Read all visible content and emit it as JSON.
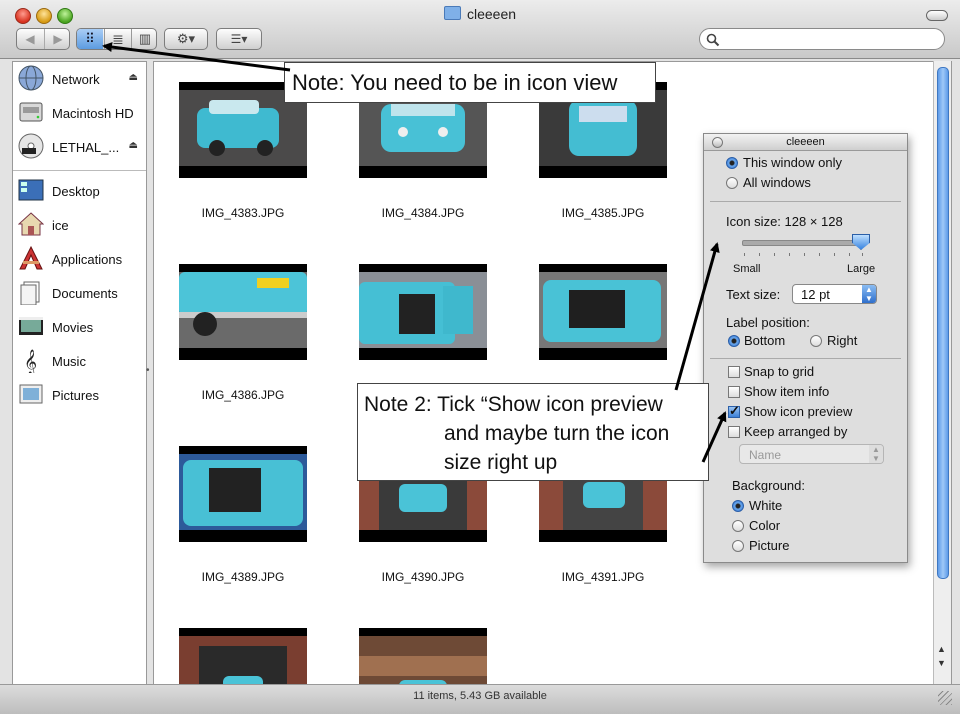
{
  "window": {
    "title": "cleeeen"
  },
  "toolbar": {
    "back_forward": [
      "◀",
      "▶"
    ],
    "view_modes": [
      {
        "name": "icon-view",
        "glyph": "⠿",
        "active": true
      },
      {
        "name": "list-view",
        "glyph": "≣",
        "active": false
      },
      {
        "name": "column-view",
        "glyph": "▥",
        "active": false
      }
    ],
    "action_glyph": "⚙▾",
    "arrange_glyph": "☰▾"
  },
  "sidebar": {
    "devices": [
      {
        "label": "Network",
        "icon": "globe-icon",
        "eject": true
      },
      {
        "label": "Macintosh HD",
        "icon": "hard-drive-icon",
        "eject": false
      },
      {
        "label": "LETHAL_...",
        "icon": "dvd-icon",
        "eject": true
      }
    ],
    "places": [
      {
        "label": "Desktop",
        "icon": "desktop-icon"
      },
      {
        "label": "ice",
        "icon": "home-icon"
      },
      {
        "label": "Applications",
        "icon": "applications-icon"
      },
      {
        "label": "Documents",
        "icon": "documents-icon"
      },
      {
        "label": "Movies",
        "icon": "movies-icon"
      },
      {
        "label": "Music",
        "icon": "music-icon"
      },
      {
        "label": "Pictures",
        "icon": "pictures-icon"
      }
    ],
    "eject_glyph": "⏏"
  },
  "files": [
    "IMG_4383.JPG",
    "IMG_4384.JPG",
    "IMG_4385.JPG",
    "IMG_4386.JPG",
    "",
    "",
    "IMG_4389.JPG",
    "IMG_4390.JPG",
    "IMG_4391.JPG",
    "",
    ""
  ],
  "status": {
    "text": "11 items, 5.43 GB available"
  },
  "inspector": {
    "title": "cleeeen",
    "scope": {
      "this_window": "This window only",
      "all_windows": "All windows",
      "selected": "this_window"
    },
    "icon_size_label": "Icon size: 128 × 128",
    "icon_size_level": 1.0,
    "slider_small": "Small",
    "slider_large": "Large",
    "text_size_label": "Text size:",
    "text_size_value": "12 pt",
    "label_position_label": "Label position:",
    "label_bottom": "Bottom",
    "label_right": "Right",
    "label_position_selected": "bottom",
    "snap_to_grid": {
      "label": "Snap to grid",
      "checked": false
    },
    "show_item_info": {
      "label": "Show item info",
      "checked": false
    },
    "show_icon_preview": {
      "label": "Show icon preview",
      "checked": true
    },
    "keep_arranged_by": {
      "label": "Keep arranged by",
      "checked": false
    },
    "arrange_value": "Name",
    "background_label": "Background:",
    "bg_white": "White",
    "bg_color": "Color",
    "bg_picture": "Picture",
    "background_selected": "white"
  },
  "callouts": {
    "note1": "Note: You need to be in icon view",
    "note2_lines": [
      "Note 2: Tick “Show icon preview",
      "and maybe turn the icon",
      "size right up"
    ]
  }
}
